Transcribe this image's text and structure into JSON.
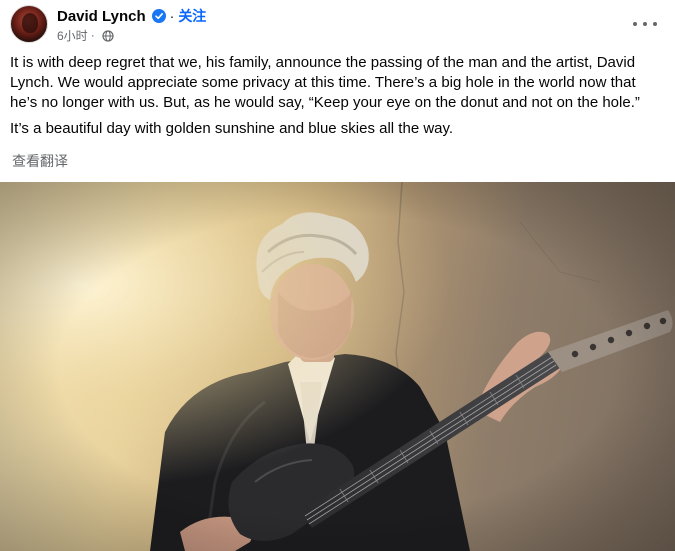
{
  "post": {
    "author": "David Lynch",
    "follow_label": "关注",
    "separator": "·",
    "time": "6小时",
    "paragraphs": [
      "It is with deep regret that we, his family, announce the passing of the man and the artist, David Lynch.  We would appreciate some privacy at this time.  There’s a big hole in the world now that he’s no longer with us.  But, as he would say, “Keep your eye on the donut and not on the hole.”",
      "It’s a beautiful day with golden sunshine and blue skies all the way."
    ],
    "translate_label": "查看翻译"
  },
  "icons": {
    "verified": "verified-badge-icon",
    "audience": "globe-icon",
    "menu": "more-options-icon"
  },
  "colors": {
    "link": "#0866ff",
    "verified": "#1877f2",
    "secondary_text": "#65676b"
  }
}
